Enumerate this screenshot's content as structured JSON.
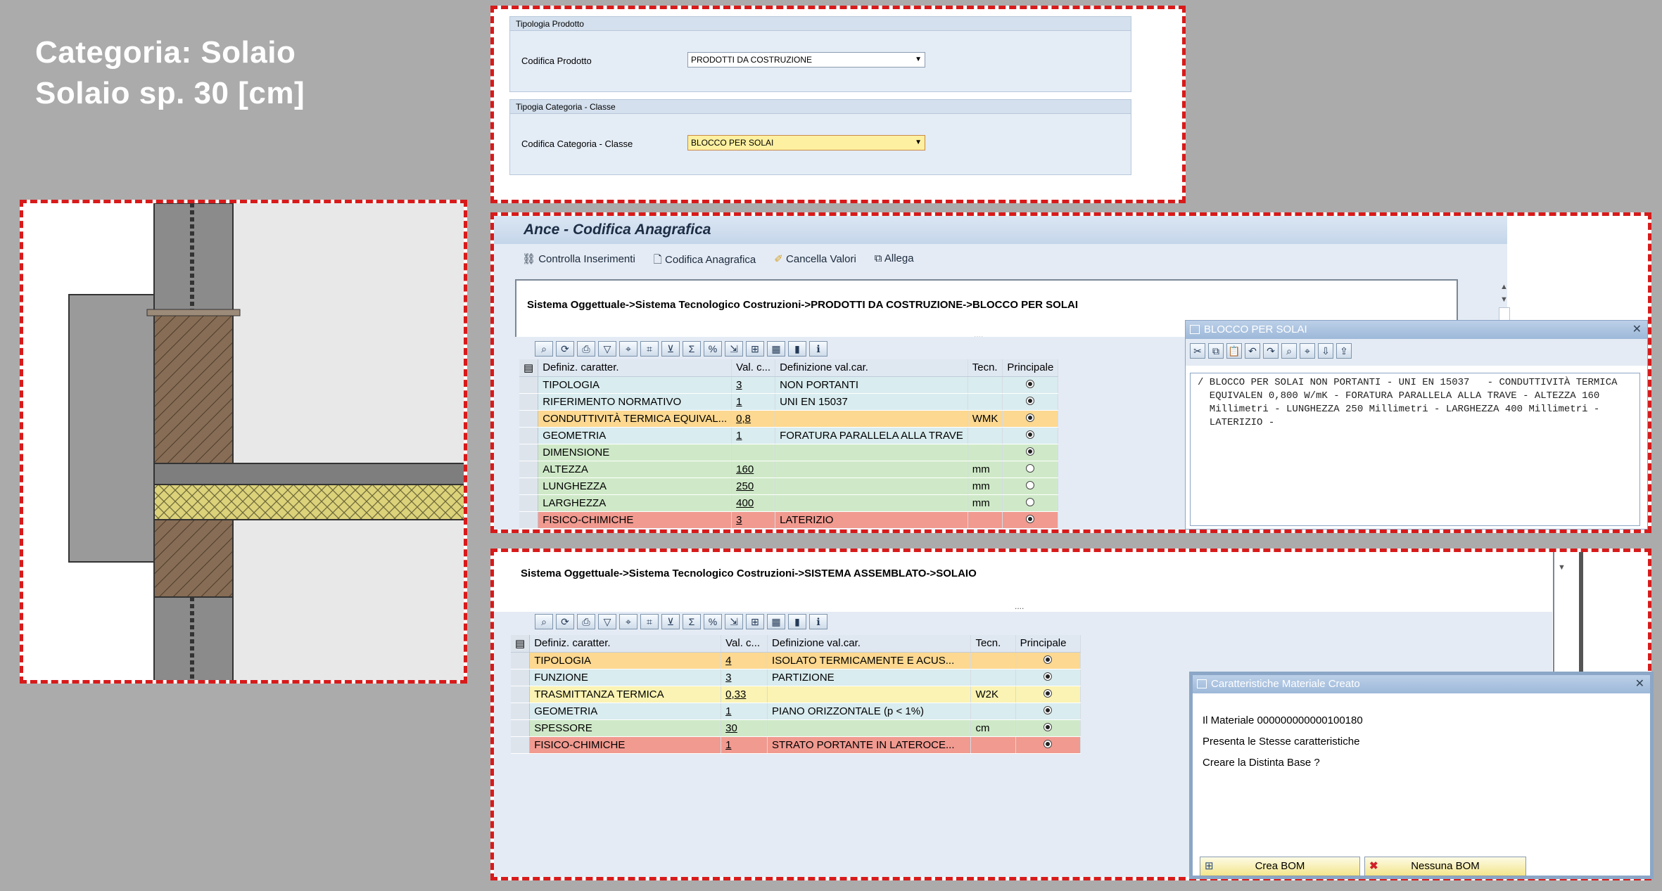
{
  "title": {
    "line1": "Categoria: Solaio",
    "line2": "Solaio sp. 30 [cm]"
  },
  "form": {
    "sec1_header": "Tipologia Prodotto",
    "sec1_label": "Codifica Prodotto",
    "sec1_value": "PRODOTTI DA COSTRUZIONE",
    "sec2_header": "Tipogia Categoria - Classe",
    "sec2_label": "Codifica Categoria - Classe",
    "sec2_value": "BLOCCO PER SOLAI"
  },
  "ance": {
    "title": "Ance - Codifica Anagrafica",
    "toolbar": [
      "Controlla Inserimenti",
      "Codifica Anagrafica",
      "Cancella Valori",
      "Allega"
    ],
    "path": "Sistema Oggettuale->Sistema Tecnologico Costruzioni->PRODOTTI DA COSTRUZIONE->BLOCCO PER SOLAI",
    "dots": "....",
    "headers": [
      "Definiz. caratter.",
      "Val. c...",
      "Definizione val.car.",
      "Tecn.",
      "Principale"
    ],
    "rows": [
      {
        "name": "TIPOLOGIA",
        "val": "3",
        "def": "NON PORTANTI",
        "tecn": "",
        "on": true,
        "color": "blue"
      },
      {
        "name": "RIFERIMENTO NORMATIVO",
        "val": "1",
        "def": "UNI EN 15037",
        "tecn": "",
        "on": true,
        "color": "blue"
      },
      {
        "name": "CONDUTTIVITÀ TERMICA EQUIVAL...",
        "val": "0,8",
        "def": "",
        "tecn": "WMK",
        "on": true,
        "color": "orange"
      },
      {
        "name": "GEOMETRIA",
        "val": "1",
        "def": "FORATURA PARALLELA ALLA TRAVE",
        "tecn": "",
        "on": true,
        "color": "blue"
      },
      {
        "name": "DIMENSIONE",
        "val": "",
        "def": "",
        "tecn": "",
        "on": true,
        "color": "green"
      },
      {
        "name": "ALTEZZA",
        "val": "160",
        "def": "",
        "tecn": "mm",
        "on": false,
        "color": "green"
      },
      {
        "name": "LUNGHEZZA",
        "val": "250",
        "def": "",
        "tecn": "mm",
        "on": false,
        "color": "green"
      },
      {
        "name": "LARGHEZZA",
        "val": "400",
        "def": "",
        "tecn": "mm",
        "on": false,
        "color": "green"
      },
      {
        "name": "FISICO-CHIMICHE",
        "val": "3",
        "def": "LATERIZIO",
        "tecn": "",
        "on": true,
        "color": "red"
      }
    ]
  },
  "popup1": {
    "title": "BLOCCO PER SOLAI",
    "text": "/ BLOCCO PER SOLAI NON PORTANTI - UNI EN 15037   - CONDUTTIVITÀ TERMICA\n  EQUIVALEN 0,800 W/mK - FORATURA PARALLELA ALLA TRAVE - ALTEZZA 160\n  Millimetri - LUNGHEZZA 250 Millimetri - LARGHEZZA 400 Millimetri -\n  LATERIZIO -"
  },
  "solaio": {
    "path": "Sistema Oggettuale->Sistema Tecnologico Costruzioni->SISTEMA ASSEMBLATO->SOLAIO",
    "dots": "....",
    "headers": [
      "Definiz. caratter.",
      "Val. c...",
      "Definizione val.car.",
      "Tecn.",
      "Principale"
    ],
    "rows": [
      {
        "name": "TIPOLOGIA",
        "val": "4",
        "def": "ISOLATO TERMICAMENTE E ACUS...",
        "tecn": "",
        "on": true,
        "color": "orange"
      },
      {
        "name": "FUNZIONE",
        "val": "3",
        "def": "PARTIZIONE",
        "tecn": "",
        "on": true,
        "color": "blue"
      },
      {
        "name": "TRASMITTANZA TERMICA",
        "val": "0,33",
        "def": "",
        "tecn": "W2K",
        "on": true,
        "color": "yellow"
      },
      {
        "name": "GEOMETRIA",
        "val": "1",
        "def": "PIANO ORIZZONTALE (p < 1%)",
        "tecn": "",
        "on": true,
        "color": "blue"
      },
      {
        "name": "SPESSORE",
        "val": "30",
        "def": "",
        "tecn": "cm",
        "on": true,
        "color": "green"
      },
      {
        "name": "FISICO-CHIMICHE",
        "val": "1",
        "def": "STRATO PORTANTE IN LATEROCE...",
        "tecn": "",
        "on": true,
        "color": "red"
      }
    ]
  },
  "popup2": {
    "title": "Caratteristiche Materiale Creato",
    "line1": "Il Materiale 000000000000100180",
    "line2": "Presenta le Stesse caratteristiche",
    "line3": "Creare la Distinta Base ?",
    "btn_yes": "Crea BOM",
    "btn_no": "Nessuna BOM"
  },
  "colors": {
    "accent_red": "#d81a1a",
    "sap_header": "#9db8d9",
    "row_blue": "#d9ecef",
    "row_green": "#cfe9c8",
    "row_red": "#f19a90",
    "row_yellow": "#fbf3b3",
    "row_orange": "#fcd890"
  }
}
